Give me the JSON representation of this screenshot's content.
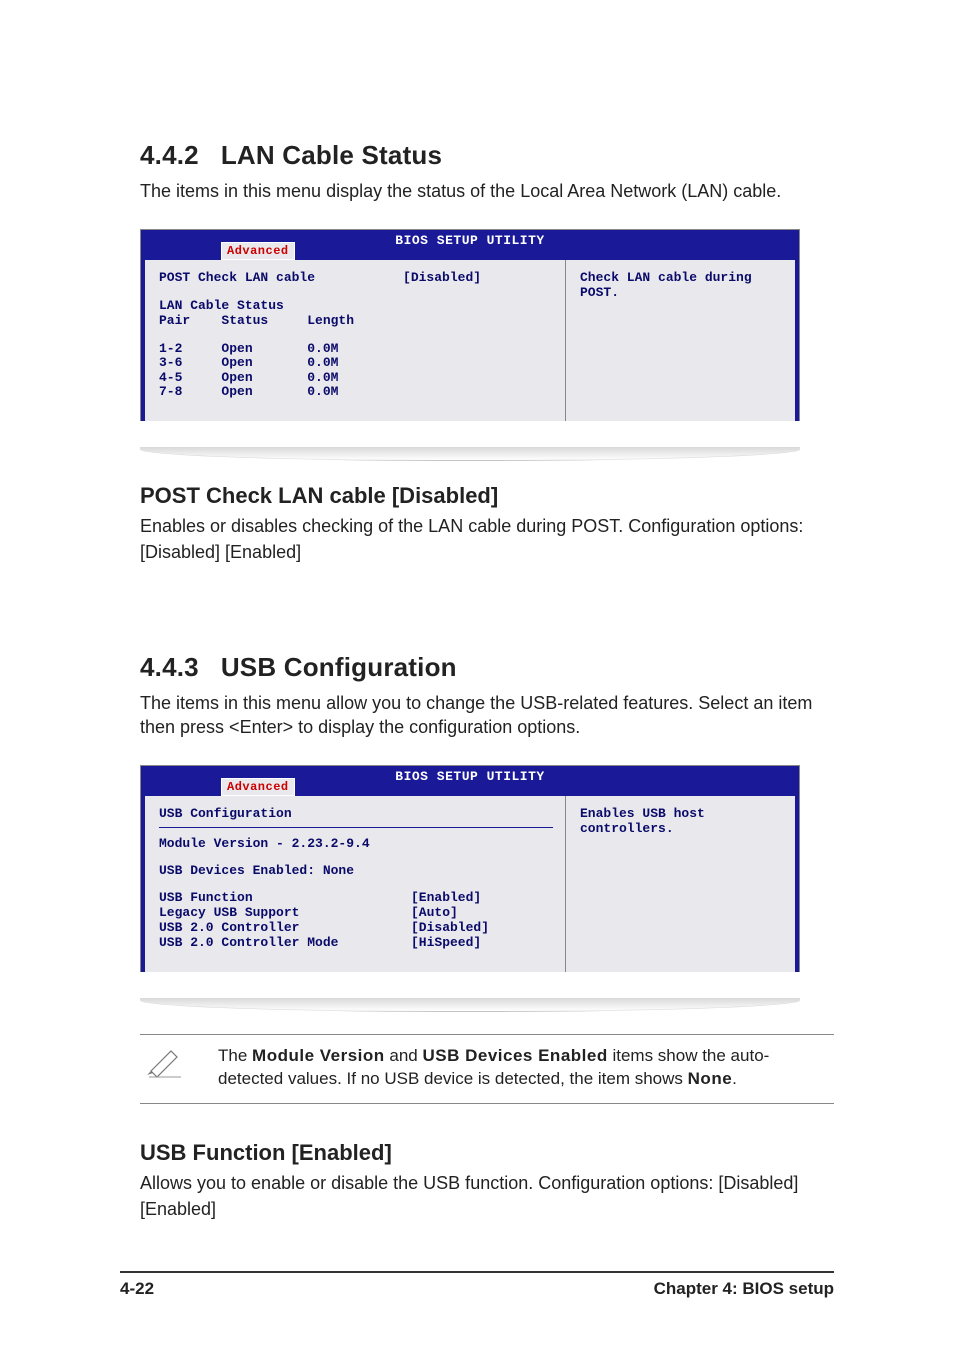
{
  "section1": {
    "number": "4.4.2",
    "title": "LAN Cable Status",
    "intro": "The items in this menu display the status of the Local Area Network (LAN) cable."
  },
  "bios1": {
    "utility_title": "BIOS SETUP UTILITY",
    "tab": "Advanced",
    "left_line1_label": "POST Check LAN cable",
    "left_line1_value": "[Disabled]",
    "left_block": "LAN Cable Status\nPair    Status     Length\n\n1-2     Open       0.0M\n3-6     Open       0.0M\n4-5     Open       0.0M\n7-8     Open       0.0M",
    "right_text": "Check LAN cable during POST."
  },
  "subsection1": {
    "heading": "POST Check LAN cable [Disabled]",
    "body": "Enables or disables checking of the LAN cable during POST. Configuration options: [Disabled] [Enabled]"
  },
  "section2": {
    "number": "4.4.3",
    "title": "USB Configuration",
    "intro": "The items in this menu allow you to change the USB-related features. Select an item then press <Enter> to display the configuration options."
  },
  "bios2": {
    "utility_title": "BIOS SETUP UTILITY",
    "tab": "Advanced",
    "l1": "USB Configuration",
    "l2": "Module Version - 2.23.2-9.4",
    "l3": "USB Devices Enabled: None",
    "row1_label": "USB Function",
    "row1_value": "[Enabled]",
    "row2_label": "Legacy USB Support",
    "row2_value": "[Auto]",
    "row3_label": "USB 2.0 Controller",
    "row3_value": "[Disabled]",
    "row4_label": "USB 2.0 Controller Mode",
    "row4_value": "[HiSpeed]",
    "right_text": "Enables USB host controllers."
  },
  "note": {
    "part1": "The ",
    "b1": "Module Version",
    "part2": " and ",
    "b2": "USB Devices Enabled",
    "part3": " items show the auto-detected values. If no USB device is detected, the item shows ",
    "b3": "None",
    "part4": "."
  },
  "subsection2": {
    "heading": "USB Function [Enabled]",
    "body": "Allows you to enable or disable the USB function. Configuration options: [Disabled] [Enabled]"
  },
  "footer": {
    "left": "4-22",
    "right": "Chapter 4: BIOS setup"
  }
}
